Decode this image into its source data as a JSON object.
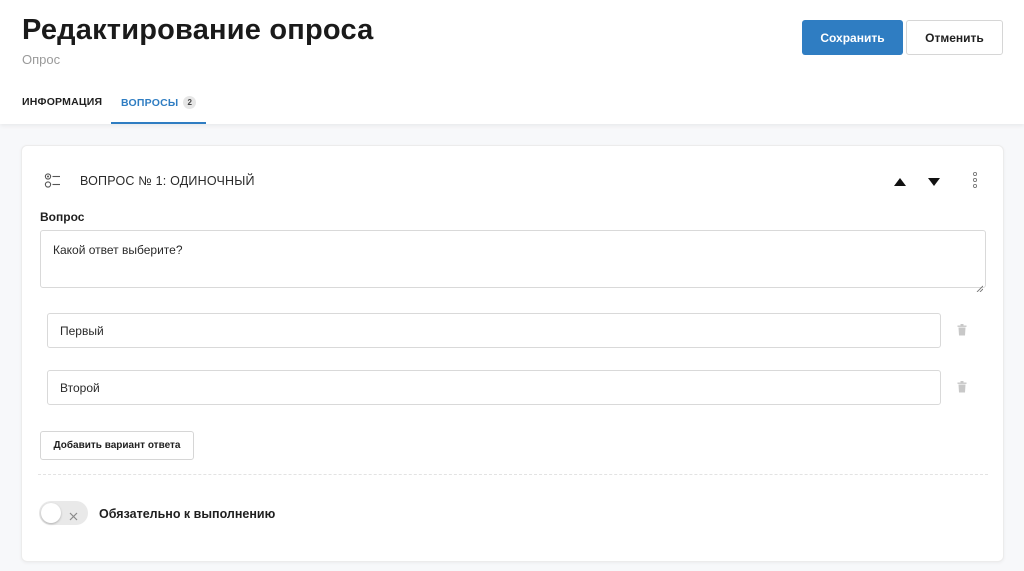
{
  "header": {
    "title": "Редактирование опроса",
    "subtitle": "Опрос",
    "save_label": "Сохранить",
    "cancel_label": "Отменить"
  },
  "tabs": [
    {
      "label": "ИНФОРМАЦИЯ",
      "active": false
    },
    {
      "label": "ВОПРОСЫ",
      "badge": "2",
      "active": true
    }
  ],
  "question": {
    "title": "ВОПРОС № 1: ОДИНОЧНЫЙ",
    "icons": [
      "single-choice-icon",
      "arrow-up-icon",
      "arrow-down-icon",
      "more-vertical-icon"
    ],
    "field_label": "Вопрос",
    "text": "Какой ответ выберите?",
    "answers": [
      {
        "value": "Первый"
      },
      {
        "value": "Второй"
      }
    ],
    "add_answer_label": "Добавить вариант ответа",
    "required_label": "Обязательно к выполнению",
    "required": false
  },
  "colors": {
    "accent": "#2f7dc2",
    "background": "#f7f8fa",
    "card": "#ffffff"
  }
}
